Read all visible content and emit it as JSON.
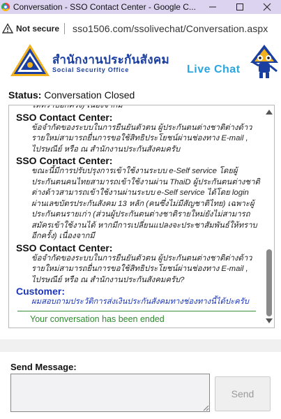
{
  "window": {
    "title": "Conversation - SSO Contact Center - Google C...",
    "minimize_icon": "minimize-icon",
    "maximize_icon": "maximize-icon",
    "close_icon": "close-icon"
  },
  "addressbar": {
    "security_label": "Not secure",
    "url": "sso1506.com/ssolivechat/Conversation.aspx"
  },
  "header": {
    "org_name_th": "สำนักงานประกันสังคม",
    "org_name_en": "Social Security Office",
    "live_chat": "Live Chat"
  },
  "status": {
    "label": "Status:",
    "value": "Conversation Closed"
  },
  "conversation": {
    "messages": [
      {
        "sender": "",
        "text": "ให้ทราบอีกครั้ง) เนื่องจากมี"
      },
      {
        "sender": "SSO Contact Center:",
        "text": "ข้อจำกัดของระบบในการยืนยันตัวตน ผู้ประกันตนต่างชาติต่างด้าว รายใหม่สามารถยื่นการขอใช้สิทธิประโยชน์ผ่านช่องทาง E-mail , ไปรษณีย์ หรือ ณ สำนักงานประกันสังคมครับ"
      },
      {
        "sender": "SSO Contact Center:",
        "text": "ขณะนี้มีการปรับปรุงการเข้าใช้งานระบบ e-Self service โดยผู้ประกันตนคนไทยสามารถเข้าใช้งานผ่าน ThaiD ผู้ประกันตนต่างชาติต่างด้าวสามารถเข้าใช้งานผ่านระบบ e-Self service ได้โดย login ผ่านเลขบัตรประกันสังคม 13 หลัก (คนซึ่งไม่มีสัญชาติไทย) เฉพาะผู้ประกันตนรายเก่า (ส่วนผู้ประกันตนต่างชาติรายใหม่ยังไม่สามารถสมัครเข้าใช้งานได้ หากมีการเปลี่ยนแปลงจะประชาสัมพันธ์ให้ทราบอีกครั้ง) เนื่องจากมี"
      },
      {
        "sender": "SSO Contact Center:",
        "text": "ข้อจำกัดของระบบในการยืนยันตัวตน ผู้ประกันตนต่างชาติต่างด้าว รายใหม่สามารถยื่นการขอใช้สิทธิประโยชน์ผ่านช่องทาง E-mail , ไปรษณีย์ หรือ ณ สำนักงานประกันสังคมครับ?"
      },
      {
        "sender": "Customer:",
        "text": "ผมสอบถามประวัติการส่งเงินประกันสังคมทางช่องทางนี้ได้ปะครับ"
      }
    ],
    "ended_notice": "Your conversation has been ended"
  },
  "compose": {
    "label": "Send Message:",
    "placeholder": "",
    "send_label": "Send"
  },
  "colors": {
    "titlebar_bg": "#dcd3f0",
    "brand_blue": "#1a3fa0",
    "live_chat_blue": "#2aa6e0",
    "customer_blue": "#1a35b8",
    "ended_green": "#2e8b2e"
  }
}
